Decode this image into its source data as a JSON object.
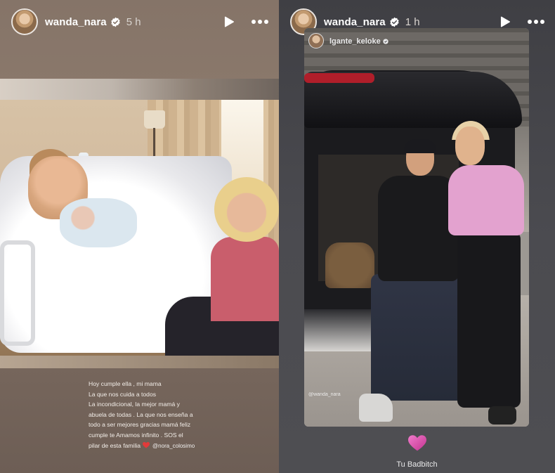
{
  "left_story": {
    "username": "wanda_nara",
    "time": "5 h",
    "caption_lines": [
      "Hoy cumple ella , mi mama",
      "La que nos cuida a todos",
      "La incondicional, la mejor mamá y",
      "abuela de todas . La que nos enseña a",
      "todo a ser mejores gracias mamá feliz",
      "cumple te Amamos infinito . SOS el",
      "pilar de esta familia"
    ],
    "mention": "@nora_colosimo"
  },
  "right_story": {
    "username": "wanda_nara",
    "time": "1 h",
    "reposted_from": "lgante_keloke",
    "photo_tag": "@wanda_nara",
    "caption": "Tu Badbitch"
  },
  "colors": {
    "left_background": "#857468",
    "right_background": "#4b4b50",
    "heart": "#d6419f",
    "verified": "#ffffff"
  },
  "icons": [
    "verified-icon",
    "play-icon",
    "more-icon",
    "heart-icon"
  ]
}
